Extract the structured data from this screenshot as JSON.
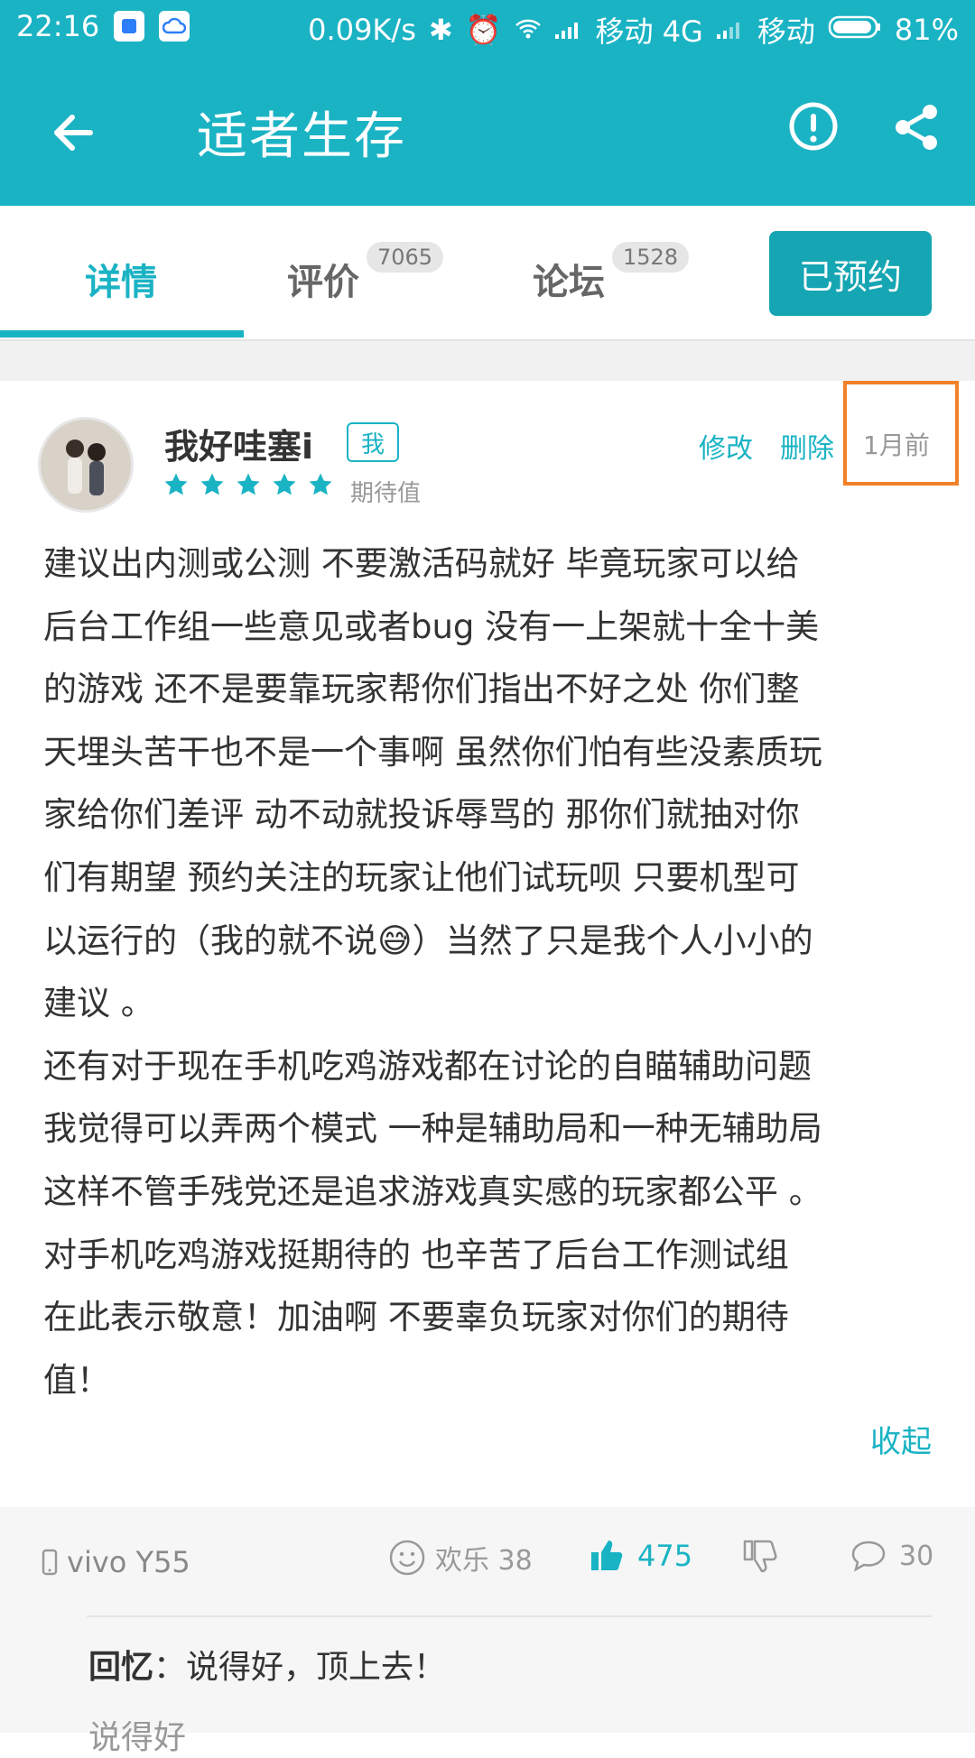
{
  "status_bar": {
    "time": "22:16",
    "net_speed": "0.09K/s",
    "carrier1": "移动 4G",
    "carrier2": "移动",
    "battery": "81%"
  },
  "app_bar": {
    "title": "适者生存",
    "back_icon": "arrow-left-icon",
    "report_icon": "exclamation-circle-icon",
    "share_icon": "share-icon"
  },
  "tabs": [
    {
      "label": "详情",
      "count": ""
    },
    {
      "label": "评价",
      "count": "7065"
    },
    {
      "label": "论坛",
      "count": "1528"
    }
  ],
  "reserve_button": "已预约",
  "review": {
    "username": "我好哇塞i",
    "me_badge": "我",
    "rating_stars": 5,
    "rating_label": "期待值",
    "edit": "修改",
    "delete": "删除",
    "time": "1月前",
    "lines": [
      "建议出内测或公测 不要激活码就好 毕竟玩家可以给",
      "后台工作组一些意见或者bug 没有一上架就十全十美",
      "的游戏 还不是要靠玩家帮你们指出不好之处 你们整",
      "天埋头苦干也不是一个事啊 虽然你们怕有些没素质玩",
      "家给你们差评 动不动就投诉辱骂的 那你们就抽对你",
      "们有期望 预约关注的玩家让他们试玩呗 只要机型可",
      "以运行的（我的就不说😅）当然了只是我个人小小的",
      "建议 。",
      "还有对于现在手机吃鸡游戏都在讨论的自瞄辅助问题",
      "我觉得可以弄两个模式 一种是辅助局和一种无辅助局",
      "这样不管手残党还是追求游戏真实感的玩家都公平 。",
      "对手机吃鸡游戏挺期待的 也辛苦了后台工作测试组",
      "在此表示敬意！加油啊 不要辜负玩家对你们的期待",
      "值！"
    ],
    "collapse": "收起"
  },
  "footer": {
    "device": "vivo Y55",
    "happy_label": "欢乐 38",
    "likes": "475",
    "comments": "30",
    "reply_user": "回忆",
    "reply_text": "：说得好，顶上去！",
    "reply2_partial": "说得好"
  },
  "colors": {
    "primary": "#1ab3c4",
    "highlight": "#f28128",
    "star": "#1ab3c4"
  }
}
